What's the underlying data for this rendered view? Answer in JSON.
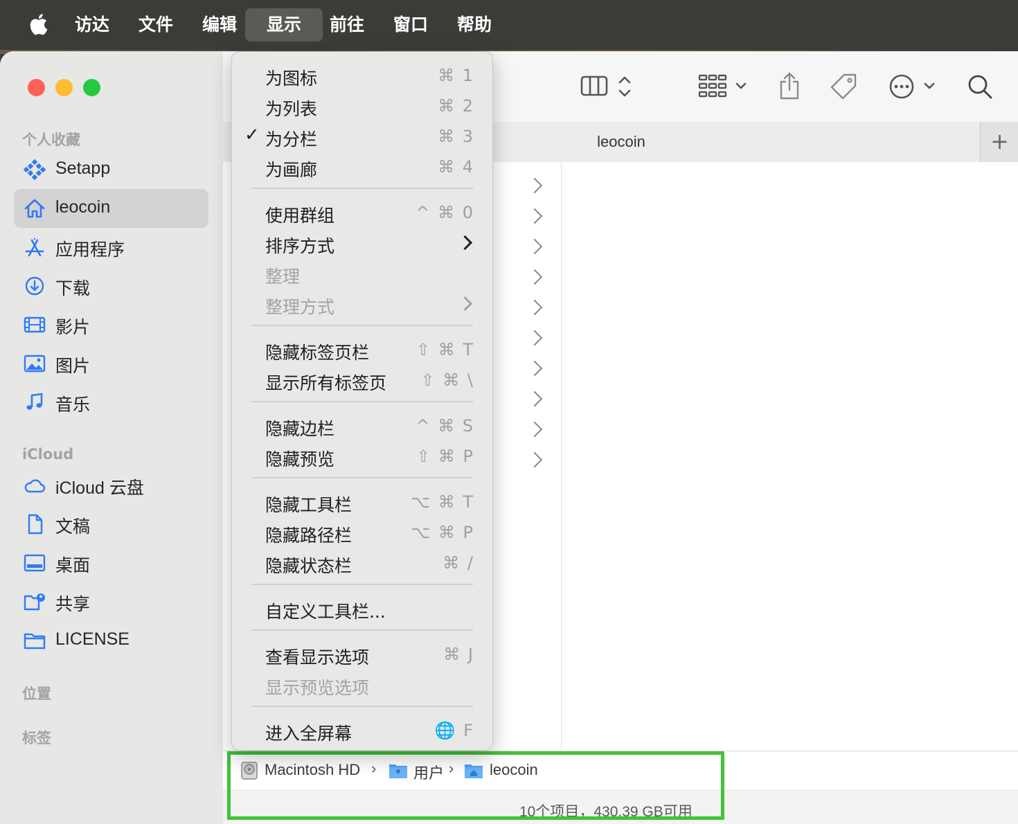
{
  "menubar": {
    "items": [
      {
        "label": "访达"
      },
      {
        "label": "文件"
      },
      {
        "label": "编辑"
      },
      {
        "label": "显示"
      },
      {
        "label": "前往"
      },
      {
        "label": "窗口"
      },
      {
        "label": "帮助"
      }
    ],
    "active_index": 3
  },
  "sidebar": {
    "sections": {
      "favorites": "个人收藏",
      "icloud": "iCloud",
      "locations": "位置",
      "tags": "标签"
    },
    "items": [
      {
        "label": "Setapp",
        "icon": "setapp-icon"
      },
      {
        "label": "leocoin",
        "icon": "home-icon",
        "selected": true
      },
      {
        "label": "应用程序",
        "icon": "applications-icon"
      },
      {
        "label": "下载",
        "icon": "download-icon"
      },
      {
        "label": "影片",
        "icon": "film-icon"
      },
      {
        "label": "图片",
        "icon": "photo-icon"
      },
      {
        "label": "音乐",
        "icon": "music-icon"
      },
      {
        "label": "iCloud 云盘",
        "icon": "cloud-icon"
      },
      {
        "label": "文稿",
        "icon": "document-icon"
      },
      {
        "label": "桌面",
        "icon": "desktop-icon"
      },
      {
        "label": "共享",
        "icon": "shared-folder-icon"
      },
      {
        "label": "LICENSE",
        "icon": "folder-icon"
      }
    ]
  },
  "tab": {
    "title": "leocoin",
    "add": "+"
  },
  "menu": {
    "items": [
      {
        "label": "为图标",
        "shortcut": "⌘ 1"
      },
      {
        "label": "为列表",
        "shortcut": "⌘ 2"
      },
      {
        "label": "为分栏",
        "shortcut": "⌘ 3",
        "checked": "✓"
      },
      {
        "label": "为画廊",
        "shortcut": "⌘ 4"
      },
      {
        "label": "使用群组",
        "shortcut": "^ ⌘ 0"
      },
      {
        "label": "排序方式",
        "submenu": true
      },
      {
        "label": "整理",
        "disabled": true
      },
      {
        "label": "整理方式",
        "submenu": true,
        "disabled": true
      },
      {
        "label": "隐藏标签页栏",
        "shortcut": "⇧ ⌘ T"
      },
      {
        "label": "显示所有标签页",
        "shortcut": "⇧ ⌘ \\"
      },
      {
        "label": "隐藏边栏",
        "shortcut": "^ ⌘ S"
      },
      {
        "label": "隐藏预览",
        "shortcut": "⇧ ⌘ P"
      },
      {
        "label": "隐藏工具栏",
        "shortcut": "⌥ ⌘ T"
      },
      {
        "label": "隐藏路径栏",
        "shortcut": "⌥ ⌘ P"
      },
      {
        "label": "隐藏状态栏",
        "shortcut": "⌘ /"
      },
      {
        "label": "自定义工具栏..."
      },
      {
        "label": "查看显示选项",
        "shortcut": "⌘ J"
      },
      {
        "label": "显示预览选项",
        "disabled": true
      },
      {
        "label": "进入全屏幕",
        "shortcut": "🌐 F"
      }
    ]
  },
  "pathbar": {
    "segments": [
      "Macintosh HD",
      "用户",
      "leocoin"
    ],
    "separator": "›"
  },
  "status": {
    "text": "10个项目，430.39 GB可用"
  },
  "colors": {
    "accent": "#2f7bf5",
    "highlight_border": "#3fc43a",
    "traffic_red": "#fe5f57",
    "traffic_yellow": "#febc2e",
    "traffic_green": "#28c840"
  }
}
